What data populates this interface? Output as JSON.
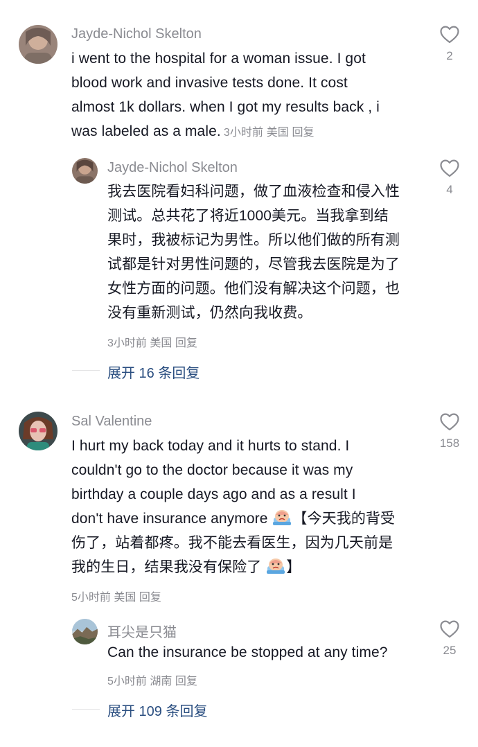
{
  "comments": [
    {
      "user": "Jayde-Nichol Skelton",
      "text": "i went to the hospital for a woman issue. I got blood work and invasive tests done. It cost almost 1k dollars. when I got my results back , i was labeled as a male.",
      "lines": [
        "i went to the hospital for a woman issue. I got",
        "blood work and invasive tests done. It cost",
        "almost 1k dollars. when I got my results back , i",
        "was labeled as a male."
      ],
      "time": "3小时前",
      "location": "美国",
      "reply_label": "回复",
      "likes": "2",
      "avatar_icon": "profile-photo",
      "replies": [
        {
          "user": "Jayde-Nichol Skelton",
          "lines": [
            "我去医院看妇科问题，做了血液检查和侵入性",
            "测试。总共花了将近1000美元。当我拿到结",
            "果时，我被标记为男性。所以他们做的所有测",
            "试都是针对男性问题的，尽管我去医院是为了",
            "女性方面的问题。他们没有解决这个问题，也",
            "没有重新测试，仍然向我收费。"
          ],
          "time": "3小时前",
          "location": "美国",
          "reply_label": "回复",
          "likes": "4"
        }
      ],
      "expand_label": "展开 16 条回复"
    },
    {
      "user": "Sal Valentine",
      "lines_a": [
        "I hurt my back today and it hurts to stand. I",
        "couldn't go to the doctor because it was my",
        "birthday a couple days ago and as a result I"
      ],
      "line_d_a": "don't have insurance anymore",
      "line_d_b": "【今天我的背受",
      "line_e": "伤了，站着都疼。我不能去看医生，因为几天前是",
      "line_f_a": "我的生日，结果我没有保险了",
      "line_f_b": "】",
      "time": "5小时前",
      "location": "美国",
      "reply_label": "回复",
      "likes": "158",
      "emoji_icon": "crying-face-emoji",
      "replies": [
        {
          "user": "耳尖是只猫",
          "text": "Can the insurance be stopped at any time?",
          "time": "5小时前",
          "location": "湖南",
          "reply_label": "回复",
          "likes": "25"
        }
      ],
      "expand_label": "展开 109 条回复"
    }
  ],
  "colors": {
    "name": "#8a8b91",
    "text": "#161823",
    "expand": "#2a4e80",
    "heart_stroke": "#8a8b91"
  },
  "icons": {
    "like": "heart-outline-icon"
  }
}
